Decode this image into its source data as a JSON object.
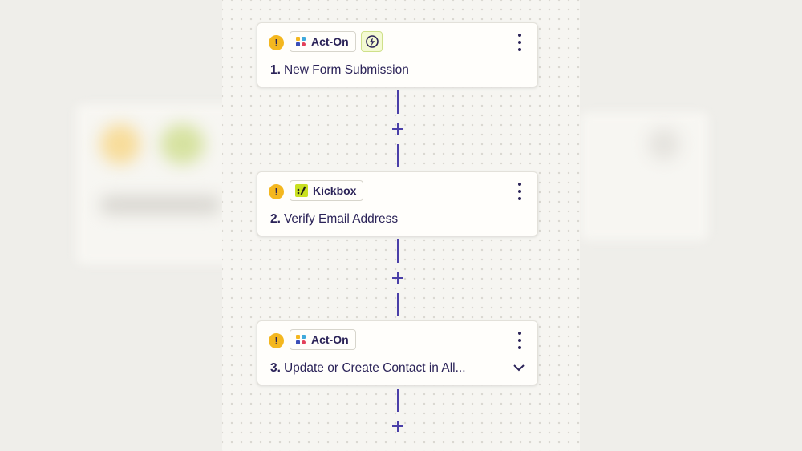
{
  "steps": [
    {
      "number": "1.",
      "title": "New Form Submission",
      "app": "Act-On",
      "app_icon": "act-on-logo-icon",
      "has_trigger_badge": true,
      "warning": true
    },
    {
      "number": "2.",
      "title": "Verify Email Address",
      "app": "Kickbox",
      "app_icon": "kickbox-logo-icon",
      "warning": true
    },
    {
      "number": "3.",
      "title": "Update or Create Contact in All...",
      "app": "Act-On",
      "app_icon": "act-on-logo-icon",
      "expandable": true,
      "warning": true
    }
  ],
  "icons": {
    "warning": "warning-icon",
    "trigger": "lightning-bolt-icon",
    "more": "more-vertical-icon",
    "add": "plus-icon",
    "expand": "chevron-down-icon"
  },
  "colors": {
    "accent": "#4a3fa8",
    "warning": "#f4b71f",
    "card_bg": "#fffefb",
    "canvas_bg": "#f6f5f1",
    "kickbox_green": "#c8e021"
  }
}
